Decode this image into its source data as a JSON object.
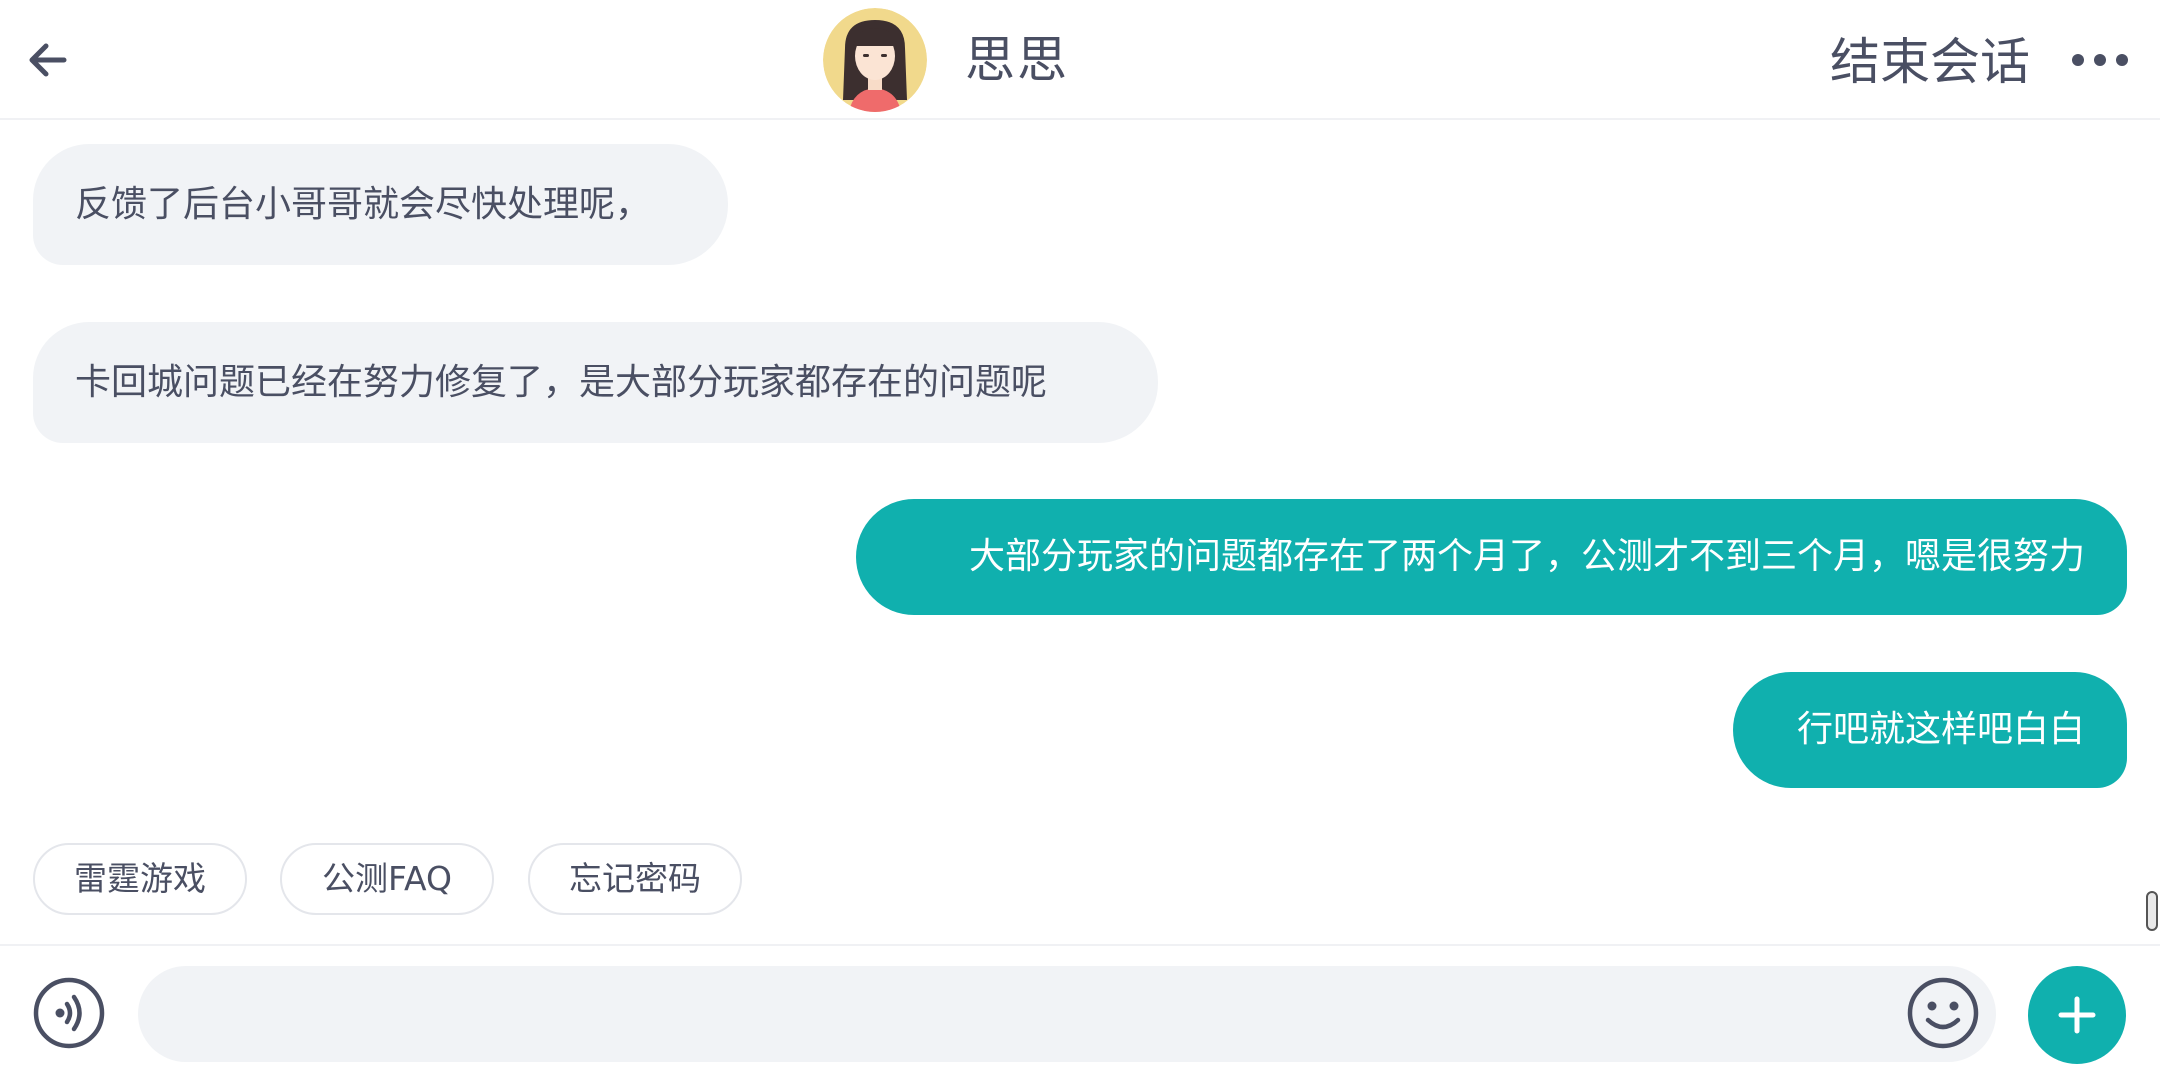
{
  "header": {
    "agent_name": "思思",
    "end_chat_label": "结束会话",
    "back_icon": "arrow-left-icon",
    "more_icon": "more-horizontal-icon"
  },
  "messages": [
    {
      "direction": "incoming",
      "text": "反馈了后台小哥哥就会尽快处理呢，"
    },
    {
      "direction": "incoming",
      "text": "卡回城问题已经在努力修复了，是大部分玩家都存在的问题呢"
    },
    {
      "direction": "outgoing",
      "text": "大部分玩家的问题都存在了两个月了，公测才不到三个月，嗯是很努力"
    },
    {
      "direction": "outgoing",
      "text": "行吧就这样吧白白"
    }
  ],
  "quick_replies": [
    "雷霆游戏",
    "公测FAQ",
    "忘记密码"
  ],
  "input": {
    "value": "",
    "placeholder": ""
  },
  "colors": {
    "accent": "#10b0ae",
    "incoming_bubble": "#f1f3f6",
    "text": "#4a4f63"
  }
}
